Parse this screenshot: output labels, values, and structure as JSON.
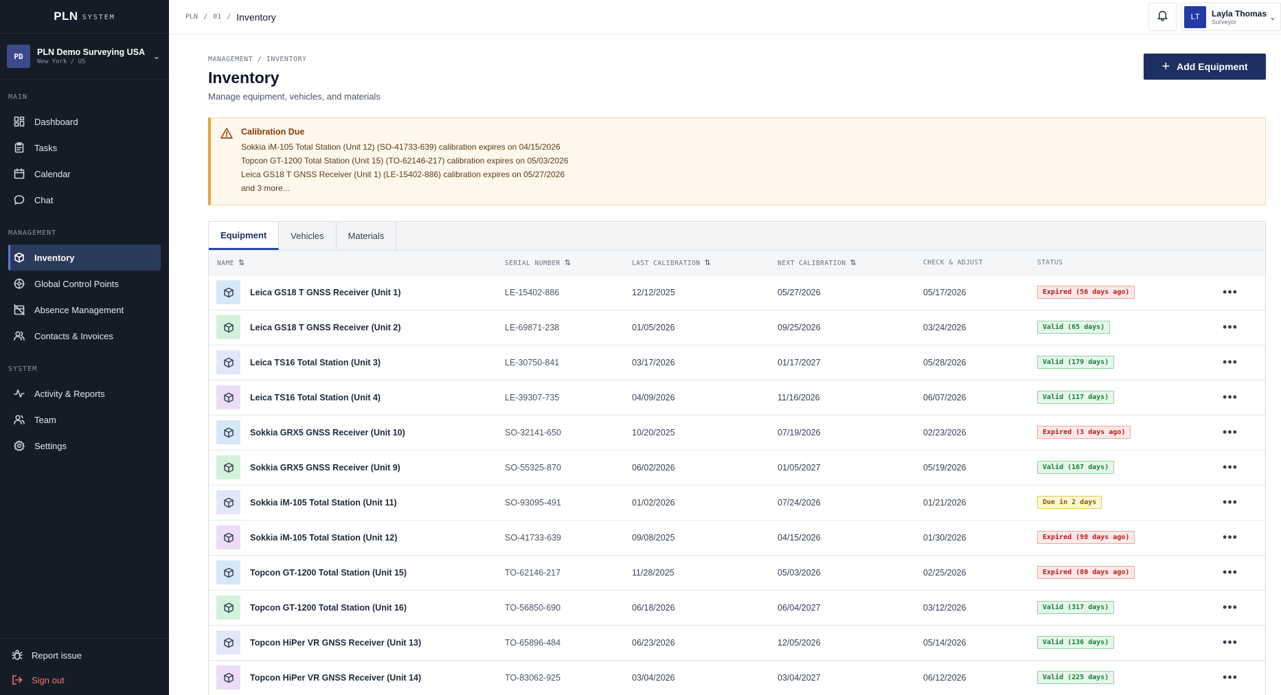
{
  "brand": {
    "main": "PLN",
    "sub": "SYSTEM"
  },
  "org": {
    "initials": "PD",
    "name": "PLN Demo Surveying USA",
    "location": "New York / US"
  },
  "sidebar": {
    "main_label": "MAIN",
    "main_items": [
      {
        "label": "Dashboard",
        "icon": "grid-icon"
      },
      {
        "label": "Tasks",
        "icon": "clipboard-icon"
      },
      {
        "label": "Calendar",
        "icon": "calendar-icon"
      },
      {
        "label": "Chat",
        "icon": "chat-icon"
      }
    ],
    "management_label": "MANAGEMENT",
    "management_items": [
      {
        "label": "Inventory",
        "icon": "box-icon",
        "active": true
      },
      {
        "label": "Global Control Points",
        "icon": "globe-icon"
      },
      {
        "label": "Absence Management",
        "icon": "calendar-off-icon"
      },
      {
        "label": "Contacts & Invoices",
        "icon": "users-icon"
      }
    ],
    "system_label": "SYSTEM",
    "system_items": [
      {
        "label": "Activity & Reports",
        "icon": "activity-icon"
      },
      {
        "label": "Team",
        "icon": "team-icon"
      },
      {
        "label": "Settings",
        "icon": "gear-icon"
      }
    ],
    "bottom": {
      "report": "Report issue",
      "signout": "Sign out"
    }
  },
  "topbar": {
    "crumbs": [
      "PLN",
      "01"
    ],
    "current": "Inventory",
    "user": {
      "initials": "LT",
      "name": "Layla Thomas",
      "role": "Surveyor"
    }
  },
  "page": {
    "crumb": "MANAGEMENT / INVENTORY",
    "title": "Inventory",
    "subtitle": "Manage equipment, vehicles, and materials",
    "add_button": "Add Equipment"
  },
  "alert": {
    "title": "Calibration Due",
    "lines": [
      "Sokkia iM-105 Total Station (Unit 12) (SO-41733-639) calibration expires on 04/15/2026",
      "Topcon GT-1200 Total Station (Unit 15) (TO-62146-217) calibration expires on 05/03/2026",
      "Leica GS18 T GNSS Receiver (Unit 1) (LE-15402-886) calibration expires on 05/27/2026",
      "and 3 more..."
    ]
  },
  "tabs": [
    "Equipment",
    "Vehicles",
    "Materials"
  ],
  "table": {
    "headers": {
      "name": "NAME",
      "serial": "SERIAL NUMBER",
      "last": "LAST CALIBRATION",
      "next": "NEXT CALIBRATION",
      "check": "CHECK & ADJUST",
      "status": "STATUS"
    },
    "rows": [
      {
        "name": "Leica GS18 T GNSS Receiver (Unit 1)",
        "serial": "LE-15402-886",
        "last": "12/12/2025",
        "next": "05/27/2026",
        "check": "05/17/2026",
        "status": "Expired (56 days ago)",
        "kind": "expired",
        "tint": "#d6e8f7"
      },
      {
        "name": "Leica GS18 T GNSS Receiver (Unit 2)",
        "serial": "LE-69871-238",
        "last": "01/05/2026",
        "next": "09/25/2026",
        "check": "03/24/2026",
        "status": "Valid (65 days)",
        "kind": "valid",
        "tint": "#d4f1dc"
      },
      {
        "name": "Leica TS16 Total Station (Unit 3)",
        "serial": "LE-30750-841",
        "last": "03/17/2026",
        "next": "01/17/2027",
        "check": "05/28/2026",
        "status": "Valid (179 days)",
        "kind": "valid",
        "tint": "#e3e6f9"
      },
      {
        "name": "Leica TS16 Total Station (Unit 4)",
        "serial": "LE-39307-735",
        "last": "04/09/2026",
        "next": "11/16/2026",
        "check": "06/07/2026",
        "status": "Valid (117 days)",
        "kind": "valid",
        "tint": "#ecdcf6"
      },
      {
        "name": "Sokkia GRX5 GNSS Receiver (Unit 10)",
        "serial": "SO-32141-650",
        "last": "10/20/2025",
        "next": "07/19/2026",
        "check": "02/23/2026",
        "status": "Expired (3 days ago)",
        "kind": "expired",
        "tint": "#d6e8f7"
      },
      {
        "name": "Sokkia GRX5 GNSS Receiver (Unit 9)",
        "serial": "SO-55325-870",
        "last": "06/02/2026",
        "next": "01/05/2027",
        "check": "05/19/2026",
        "status": "Valid (167 days)",
        "kind": "valid",
        "tint": "#d4f1dc"
      },
      {
        "name": "Sokkia iM-105 Total Station (Unit 11)",
        "serial": "SO-93095-491",
        "last": "01/02/2026",
        "next": "07/24/2026",
        "check": "01/21/2026",
        "status": "Due in 2 days",
        "kind": "due",
        "tint": "#e3e6f9"
      },
      {
        "name": "Sokkia iM-105 Total Station (Unit 12)",
        "serial": "SO-41733-639",
        "last": "09/08/2025",
        "next": "04/15/2026",
        "check": "01/30/2026",
        "status": "Expired (98 days ago)",
        "kind": "expired",
        "tint": "#ecdcf6"
      },
      {
        "name": "Topcon GT-1200 Total Station (Unit 15)",
        "serial": "TO-62146-217",
        "last": "11/28/2025",
        "next": "05/03/2026",
        "check": "02/25/2026",
        "status": "Expired (80 days ago)",
        "kind": "expired",
        "tint": "#d6e8f7"
      },
      {
        "name": "Topcon GT-1200 Total Station (Unit 16)",
        "serial": "TO-56850-690",
        "last": "06/18/2026",
        "next": "06/04/2027",
        "check": "03/12/2026",
        "status": "Valid (317 days)",
        "kind": "valid",
        "tint": "#d4f1dc"
      },
      {
        "name": "Topcon HiPer VR GNSS Receiver (Unit 13)",
        "serial": "TO-65896-484",
        "last": "06/23/2026",
        "next": "12/05/2026",
        "check": "05/14/2026",
        "status": "Valid (136 days)",
        "kind": "valid",
        "tint": "#e3e6f9"
      },
      {
        "name": "Topcon HiPer VR GNSS Receiver (Unit 14)",
        "serial": "TO-83062-925",
        "last": "03/04/2026",
        "next": "03/04/2027",
        "check": "06/12/2026",
        "status": "Valid (225 days)",
        "kind": "valid",
        "tint": "#ecdcf6"
      }
    ]
  },
  "colors": {
    "sidebar_bg": "#141c27",
    "accent": "#1e2f62",
    "alert_bg": "#fef8ec"
  }
}
